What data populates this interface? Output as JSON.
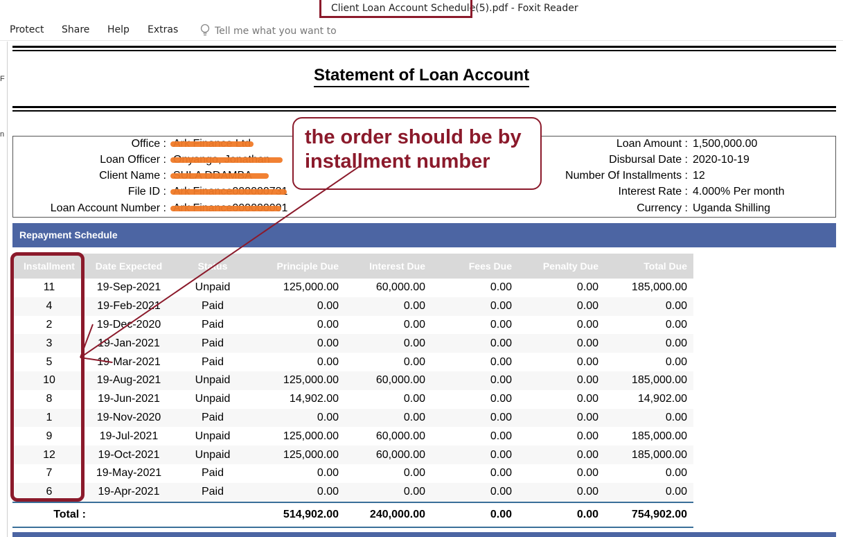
{
  "window": {
    "title": "Client Loan Account Schedule(5).pdf - Foxit Reader"
  },
  "ribbon": {
    "menus": [
      "Protect",
      "Share",
      "Help",
      "Extras"
    ],
    "search_placeholder": "Tell me what you want to"
  },
  "sidebar": {
    "glyphs": [
      "F",
      "n"
    ]
  },
  "document": {
    "title": "Statement of Loan Account",
    "left_info": [
      {
        "label": "Office :",
        "value": "Ark Finance Ltd"
      },
      {
        "label": "Loan Officer :",
        "value": "Onyango, Jonathan"
      },
      {
        "label": "Client Name :",
        "value": "SULA DDAMBA"
      },
      {
        "label": "File ID :",
        "value": "Ark Finance000000731"
      },
      {
        "label": "Loan Account Number :",
        "value": "Ark Finance000000001"
      }
    ],
    "right_info": [
      {
        "label": "Loan Amount :",
        "value": "1,500,000.00"
      },
      {
        "label": "Disbursal Date :",
        "value": "2020-10-19"
      },
      {
        "label": "Number Of Installments :",
        "value": "12"
      },
      {
        "label": "Interest Rate :",
        "value": "4.000% Per month"
      },
      {
        "label": "Currency :",
        "value": "Uganda Shilling"
      }
    ],
    "section_title": "Repayment Schedule",
    "table": {
      "headers": [
        "Installment",
        "Date Expected",
        "Status",
        "Principle Due",
        "Interest Due",
        "Fees Due",
        "Penalty Due",
        "Total Due"
      ],
      "rows": [
        [
          "11",
          "19-Sep-2021",
          "Unpaid",
          "125,000.00",
          "60,000.00",
          "0.00",
          "0.00",
          "185,000.00"
        ],
        [
          "4",
          "19-Feb-2021",
          "Paid",
          "0.00",
          "0.00",
          "0.00",
          "0.00",
          "0.00"
        ],
        [
          "2",
          "19-Dec-2020",
          "Paid",
          "0.00",
          "0.00",
          "0.00",
          "0.00",
          "0.00"
        ],
        [
          "3",
          "19-Jan-2021",
          "Paid",
          "0.00",
          "0.00",
          "0.00",
          "0.00",
          "0.00"
        ],
        [
          "5",
          "19-Mar-2021",
          "Paid",
          "0.00",
          "0.00",
          "0.00",
          "0.00",
          "0.00"
        ],
        [
          "10",
          "19-Aug-2021",
          "Unpaid",
          "125,000.00",
          "60,000.00",
          "0.00",
          "0.00",
          "185,000.00"
        ],
        [
          "8",
          "19-Jun-2021",
          "Unpaid",
          "14,902.00",
          "0.00",
          "0.00",
          "0.00",
          "14,902.00"
        ],
        [
          "1",
          "19-Nov-2020",
          "Paid",
          "0.00",
          "0.00",
          "0.00",
          "0.00",
          "0.00"
        ],
        [
          "9",
          "19-Jul-2021",
          "Unpaid",
          "125,000.00",
          "60,000.00",
          "0.00",
          "0.00",
          "185,000.00"
        ],
        [
          "12",
          "19-Oct-2021",
          "Unpaid",
          "125,000.00",
          "60,000.00",
          "0.00",
          "0.00",
          "185,000.00"
        ],
        [
          "7",
          "19-May-2021",
          "Paid",
          "0.00",
          "0.00",
          "0.00",
          "0.00",
          "0.00"
        ],
        [
          "6",
          "19-Apr-2021",
          "Paid",
          "0.00",
          "0.00",
          "0.00",
          "0.00",
          "0.00"
        ]
      ],
      "totals": {
        "label": "Total :",
        "principle": "514,902.00",
        "interest": "240,000.00",
        "fees": "0.00",
        "penalty": "0.00",
        "total": "754,902.00"
      }
    }
  },
  "annotation": {
    "text": "the order should be by installment number",
    "color": "#8b1a2b"
  },
  "colors": {
    "section_bar": "#4c65a3",
    "header_bg": "#d9d9d9",
    "redaction": "#f07a28"
  },
  "icons": {
    "search": "lightbulb-icon"
  }
}
